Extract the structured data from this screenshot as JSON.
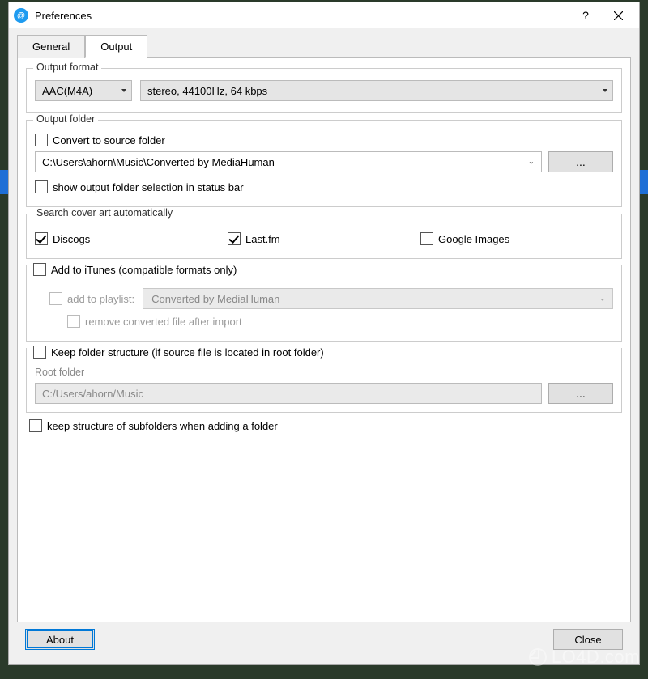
{
  "window": {
    "title": "Preferences"
  },
  "tabs": {
    "general": "General",
    "output": "Output"
  },
  "output_format": {
    "legend": "Output format",
    "format": "AAC(M4A)",
    "quality": "stereo, 44100Hz, 64 kbps"
  },
  "output_folder": {
    "legend": "Output folder",
    "convert_source": "Convert to source folder",
    "path": "C:\\Users\\ahorn\\Music\\Converted by MediaHuman",
    "browse": "...",
    "show_status": "show output folder selection in status bar"
  },
  "cover_art": {
    "legend": "Search cover art automatically",
    "discogs": "Discogs",
    "lastfm": "Last.fm",
    "google": "Google Images"
  },
  "itunes": {
    "add_itunes": "Add to iTunes (compatible formats only)",
    "add_playlist_label": "add to playlist:",
    "playlist_value": "Converted by MediaHuman",
    "remove_after": "remove converted file after import"
  },
  "folder_structure": {
    "keep": "Keep folder structure (if source file is located in root folder)",
    "root_label": "Root folder",
    "root_path": "C:/Users/ahorn/Music",
    "browse": "..."
  },
  "keep_subfolders": "keep structure of subfolders when adding a folder",
  "footer": {
    "about": "About",
    "close": "Close"
  },
  "watermark": "LO4D.com"
}
